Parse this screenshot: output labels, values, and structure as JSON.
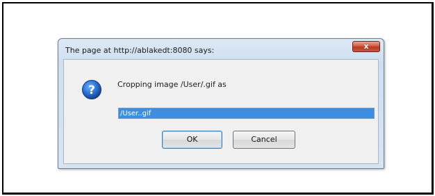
{
  "dialog": {
    "title": "The page at http://ablakedt:8080 says:",
    "close_label": "x",
    "icon": "question-icon",
    "message": "Cropping image /User/.gif  as",
    "input_value": "/User..gif",
    "ok_label": "OK",
    "cancel_label": "Cancel"
  },
  "colors": {
    "selection": "#3d8ee0",
    "close_button": "#c9553b",
    "icon": "#1f5fb8"
  }
}
